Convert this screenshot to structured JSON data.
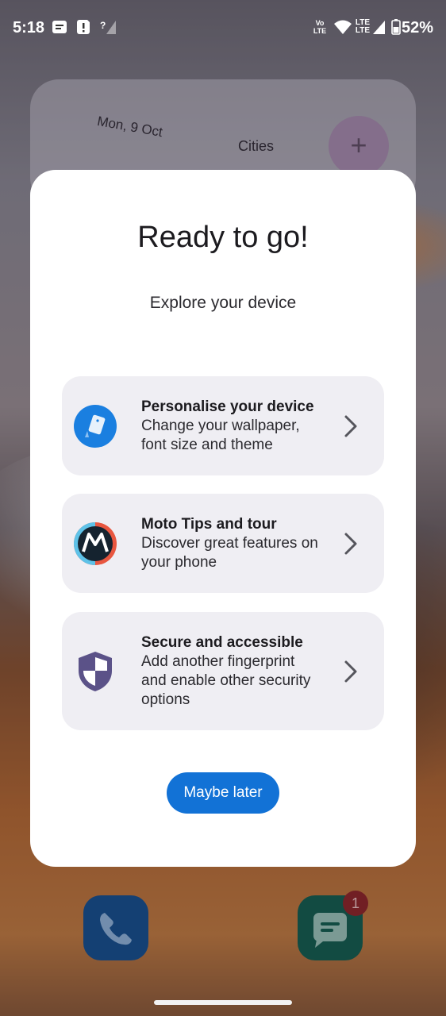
{
  "status_bar": {
    "time": "5:18",
    "network_label_top": "Vo",
    "network_label_bottom": "LTE",
    "lte_top": "LTE",
    "lte_bottom": "LTE",
    "battery": "52%",
    "icons": [
      "message-notification-icon",
      "alert-notification-icon",
      "no-signal-icon",
      "volte-icon",
      "wifi-icon",
      "lte-signal-icon",
      "battery-icon"
    ]
  },
  "background_widget": {
    "date": "Mon, 9 Oct",
    "cities_label": "Cities",
    "add_symbol": "+"
  },
  "dialog": {
    "title": "Ready to go!",
    "subtitle": "Explore your device",
    "options": [
      {
        "title": "Personalise your device",
        "description": "Change your wallpaper, font size and theme",
        "icon": "personalise-icon"
      },
      {
        "title": "Moto Tips and tour",
        "description": "Discover great features on your phone",
        "icon": "moto-logo-icon"
      },
      {
        "title": "Secure and accessible",
        "description": "Add another fingerprint and enable other security options",
        "icon": "shield-icon"
      }
    ],
    "dismiss_button": "Maybe later"
  },
  "dock": {
    "apps": [
      "Phone",
      "Messages"
    ],
    "messages_badge": "1"
  },
  "colors": {
    "accent": "#1272d6",
    "card_background": "#efeef3",
    "dialog_background": "#ffffff",
    "shield": "#5b5288"
  }
}
